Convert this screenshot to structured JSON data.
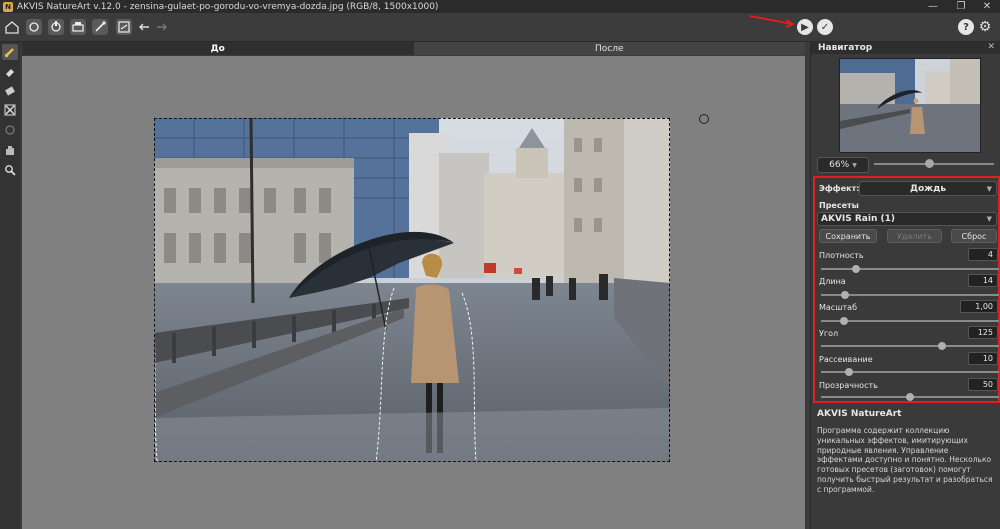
{
  "titlebar": {
    "title": "AKVIS NatureArt v.12.0 - zensina-gulaet-po-gorodu-vo-vremya-dozda.jpg (RGB/8, 1500x1000)",
    "logo": "N"
  },
  "window_controls": {
    "minimize": "—",
    "restore": "❐",
    "close": "✕"
  },
  "toolbar": {
    "icons": [
      "home-icon",
      "open-file-icon",
      "save-file-icon",
      "print-icon",
      "share-icon",
      "batch-icon",
      "undo-icon",
      "redo-icon",
      "run-icon",
      "apply-icon",
      "help-icon",
      "settings-icon"
    ],
    "run_glyph": "▶",
    "apply_glyph": "✓",
    "help_glyph": "?",
    "settings_glyph": "⚙"
  },
  "tools": [
    "brush-icon",
    "eraser-icon",
    "gradient-icon",
    "crop-icon",
    "history-brush-icon",
    "hand-icon",
    "zoom-icon"
  ],
  "tabs": {
    "before": "До",
    "after": "После"
  },
  "navigator": {
    "title": "Навигатор",
    "close": "✕",
    "zoom": "66%"
  },
  "settings": {
    "effect_label": "Эффект:",
    "effect_value": "Дождь",
    "presets_label": "Пресеты",
    "preset_value": "AKVIS Rain (1)",
    "save_label": "Сохранить",
    "delete_label": "Удалить",
    "reset_label": "Сброс",
    "params": [
      {
        "label": "Плотность",
        "value": "4",
        "level": 0.18
      },
      {
        "label": "Длина",
        "value": "14",
        "level": 0.12
      },
      {
        "label": "Масштаб",
        "value": "1,00",
        "level": 0.11
      },
      {
        "label": "Угол",
        "value": "125",
        "level": 0.69
      },
      {
        "label": "Рассеивание",
        "value": "10",
        "level": 0.14
      },
      {
        "label": "Прозрачность",
        "value": "50",
        "level": 0.5
      }
    ]
  },
  "about": {
    "title": "AKVIS NatureArt",
    "text": "Программа содержит коллекцию уникальных эффектов, имитирующих природные явления. Управление эффектами доступно и понятно. Несколько готовых пресетов (заготовок) помогут получить быстрый результат и разобраться с программой."
  },
  "colors": {
    "accent_red": "#e02020",
    "canvas_gray": "#808080",
    "panel": "#3a3a3a"
  }
}
